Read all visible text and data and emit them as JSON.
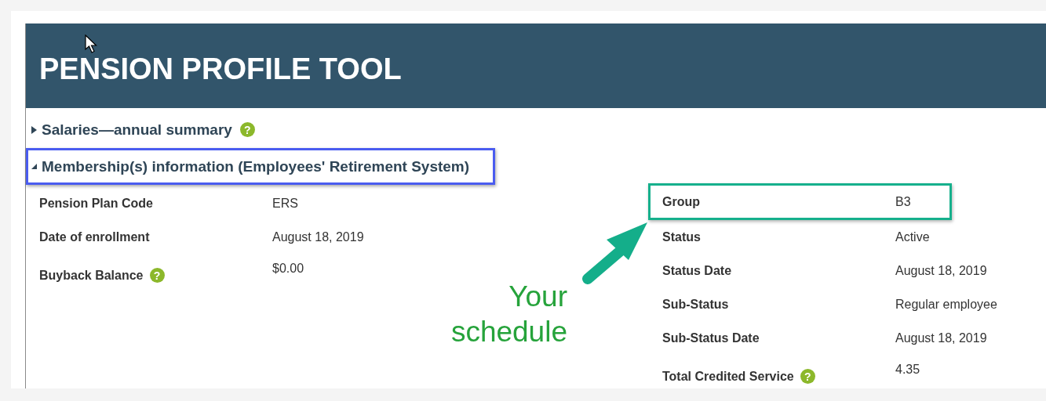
{
  "title": "PENSION PROFILE TOOL",
  "sections": [
    {
      "title": "Salaries—annual summary",
      "expanded": false,
      "highlighted": false,
      "help": "?"
    },
    {
      "title": "Membership(s) information (Employees' Retirement System)",
      "expanded": true,
      "highlighted": true
    }
  ],
  "fields_left": [
    {
      "label": "Pension Plan Code",
      "value": "ERS",
      "highlighted": false
    },
    {
      "label": "Date of enrollment",
      "value": "August 18, 2019",
      "highlighted": false
    },
    {
      "label": "Buyback Balance",
      "value": "$0.00",
      "highlighted": false,
      "help": "?"
    }
  ],
  "fields_right": [
    {
      "label": "Group",
      "value": "B3",
      "highlighted": true
    },
    {
      "label": "Status",
      "value": "Active",
      "highlighted": false
    },
    {
      "label": "Status Date",
      "value": "August 18, 2019",
      "highlighted": false
    },
    {
      "label": "Sub-Status",
      "value": "Regular employee",
      "highlighted": false
    },
    {
      "label": "Sub-Status Date",
      "value": "August 18, 2019",
      "highlighted": false
    },
    {
      "label": "Total Credited Service",
      "value": "4.35",
      "highlighted": false,
      "help": "?"
    }
  ],
  "callout": {
    "text": "Your schedule"
  }
}
